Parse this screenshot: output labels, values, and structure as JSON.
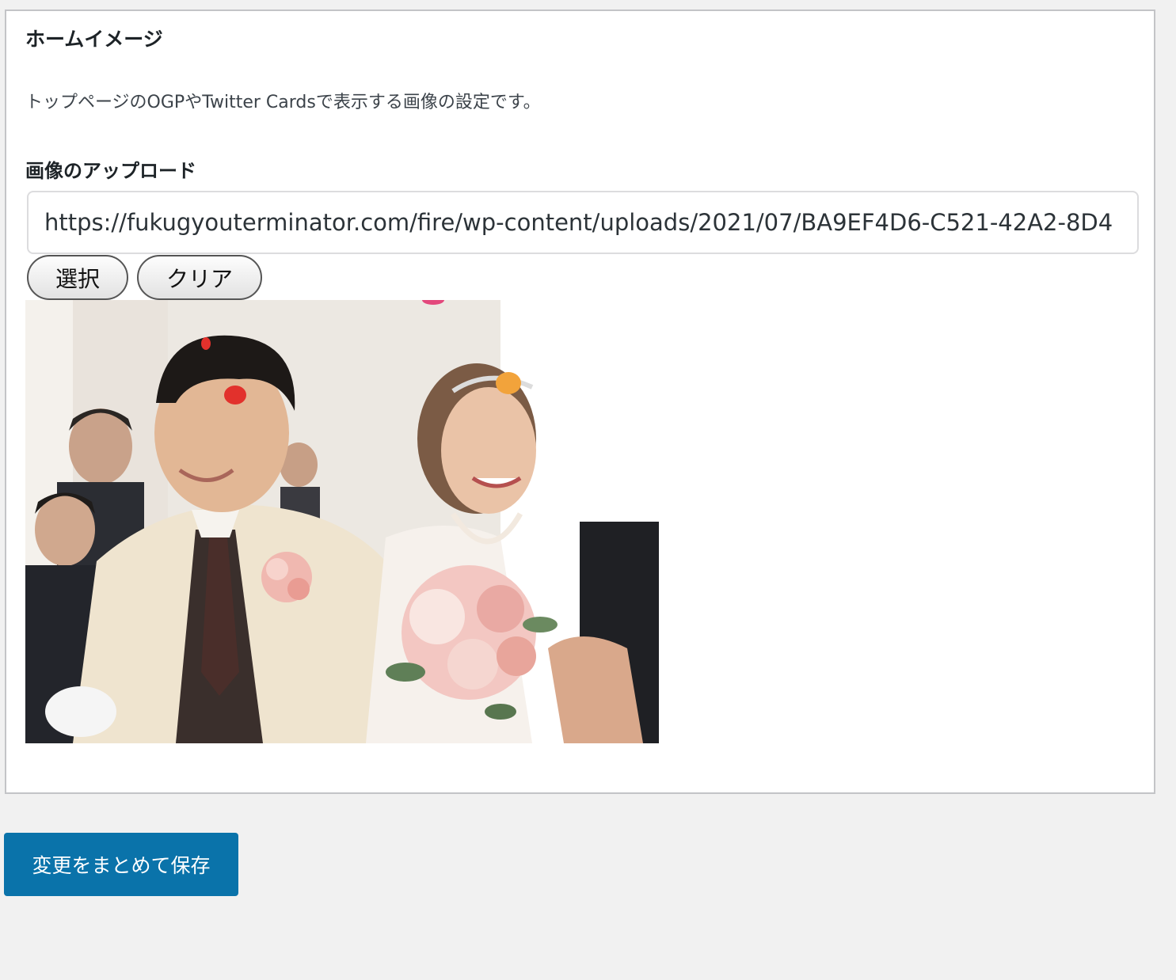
{
  "panel": {
    "title": "ホームイメージ",
    "description": "トップページのOGPやTwitter Cardsで表示する画像の設定です。",
    "field_label": "画像のアップロード",
    "url_value": "https://fukugyouterminator.com/fire/wp-content/uploads/2021/07/BA9EF4D6-C521-42A2-8D4",
    "buttons": {
      "select_label": "選択",
      "clear_label": "クリア"
    },
    "preview_image": {
      "subject": "wedding-couple-photo"
    }
  },
  "footer": {
    "save_label": "変更をまとめて保存"
  },
  "colors": {
    "primary_button": "#0a73aa",
    "panel_bg": "#ffffff",
    "page_bg": "#f1f1f1"
  }
}
